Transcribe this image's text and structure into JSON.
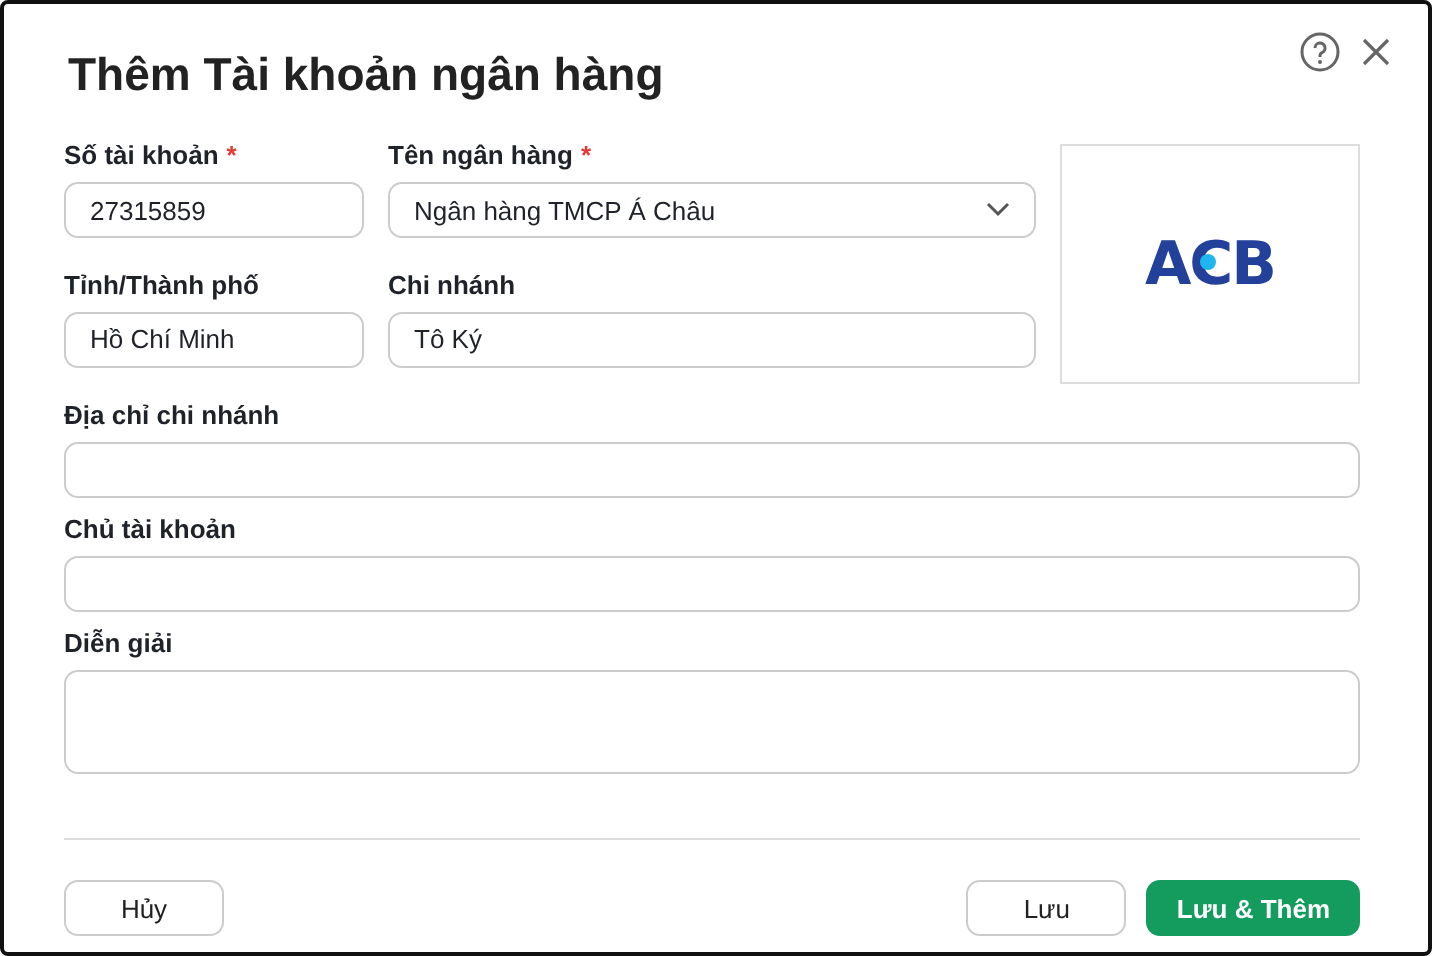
{
  "dialog": {
    "title": "Thêm Tài khoản ngân hàng"
  },
  "top_fields": [
    {
      "kind": "text",
      "label": "Số tài khoản",
      "required_mark": "*",
      "value": "27315859"
    },
    {
      "kind": "select",
      "label": "Tên ngân hàng",
      "required_mark": "*",
      "value": "Ngân hàng TMCP Á Châu"
    },
    {
      "kind": "text",
      "label": "Tỉnh/Thành phố",
      "value": "Hồ Chí Minh"
    },
    {
      "kind": "text",
      "label": "Chi nhánh",
      "value": "Tô Ký"
    }
  ],
  "bank_logo": {
    "text": "ACB"
  },
  "fields": [
    {
      "kind": "text",
      "label": "Địa chỉ chi nhánh"
    },
    {
      "kind": "text",
      "label": "Chủ tài khoản"
    },
    {
      "kind": "textarea",
      "label": "Diễn giải"
    }
  ],
  "buttons": [
    {
      "label": "Hủy",
      "kind": "secondary"
    },
    {
      "label": "Lưu",
      "kind": "secondary"
    },
    {
      "label": "Lưu & Thêm",
      "kind": "primary"
    }
  ]
}
